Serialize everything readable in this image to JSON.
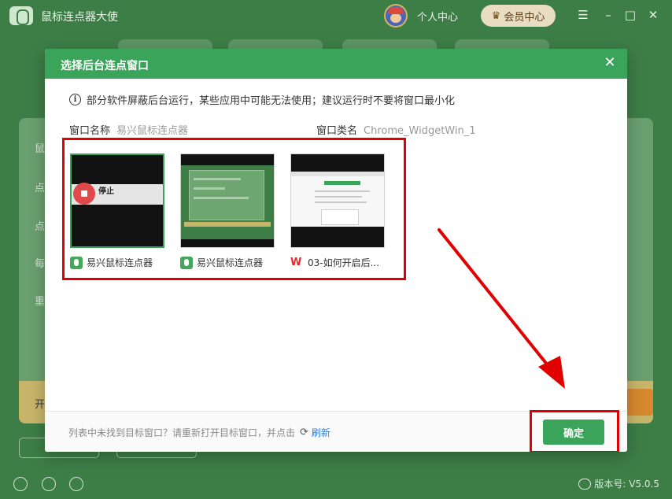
{
  "app": {
    "title": "鼠标连点器大使",
    "personal_center": "个人中心",
    "vip_center": "会员中心",
    "minimize": "–",
    "maximize": "□",
    "close": "✕",
    "menu": "☰",
    "bg_side_labels": [
      "鼠",
      "点",
      "点",
      "每",
      "重"
    ],
    "bg_kai": "开",
    "version": "版本号: V5.0.5"
  },
  "dialog": {
    "title": "选择后台连点窗口",
    "close": "✕",
    "notice_icon": "i",
    "notice": "部分软件屏蔽后台运行，某些应用中可能无法使用；建议运行时不要将窗口最小化",
    "window_name_label": "窗口名称",
    "window_name_value": "易兴鼠标连点器",
    "window_class_label": "窗口类名",
    "window_class_value": "Chrome_WidgetWin_1",
    "windows": [
      {
        "label": "易兴鼠标连点器",
        "icon": "mouse-app-icon",
        "selected": true,
        "thumb_text": "停止"
      },
      {
        "label": "易兴鼠标连点器",
        "icon": "mouse-app-icon",
        "selected": false
      },
      {
        "label": "03-如何开启后...",
        "icon": "wps-icon",
        "selected": false
      }
    ],
    "footer_text": "列表中未找到目标窗口？请重新打开目标窗口，并点击",
    "refresh_icon": "⟳",
    "refresh_label": "刷新",
    "confirm_label": "确定"
  },
  "colors": {
    "accent_green": "#3aa55a",
    "highlight_red": "#e00000",
    "link_blue": "#2f7cdb"
  }
}
